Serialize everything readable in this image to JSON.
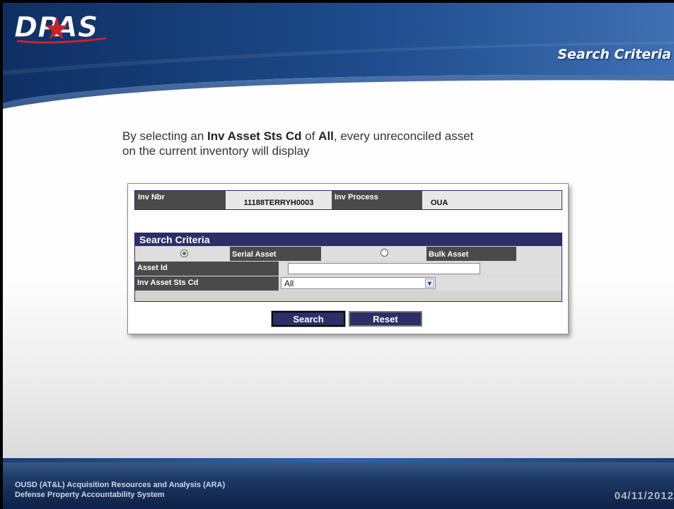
{
  "header": {
    "logo_text": "DPAS",
    "slide_title": "Search Criteria"
  },
  "caption": {
    "part1": "By selecting an ",
    "bold1": "Inv Asset Sts Cd",
    "part2": " of ",
    "bold2": "All",
    "part3": ", every unreconciled asset",
    "line2": "on the current  inventory will display"
  },
  "inventory": {
    "inv_nbr_label": "Inv Nbr",
    "inv_nbr_value": "11188TERRYH0003",
    "inv_process_label": "Inv Process",
    "inv_process_value": "OUA"
  },
  "search_panel": {
    "title": "Search Criteria",
    "serial_label": "Serial Asset",
    "serial_selected": true,
    "bulk_label": "Bulk Asset",
    "asset_id_label": "Asset Id",
    "asset_id_value": "",
    "sts_label": "Inv Asset Sts Cd",
    "sts_value": "All"
  },
  "buttons": {
    "search": "Search",
    "reset": "Reset"
  },
  "footer": {
    "org_line1": "OUSD (AT&L) Acquisition Resources and Analysis (ARA)",
    "org_line2": "Defense Property Accountability System",
    "date": "04/11/2012"
  },
  "colors": {
    "header_blue": "#1e4c8c",
    "panel_navy": "#2b2f66",
    "label_gray": "#4a4a4a",
    "logo_red": "#c8242b"
  }
}
